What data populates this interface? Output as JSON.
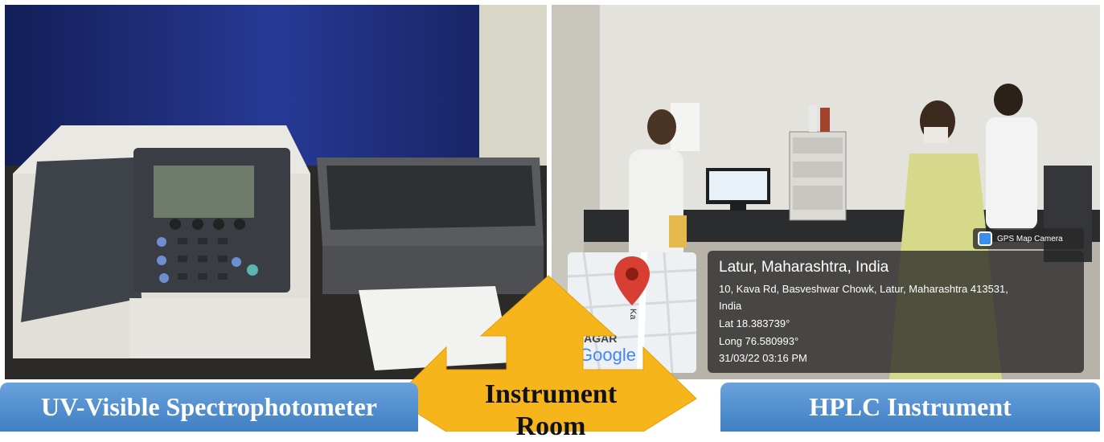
{
  "labels": {
    "left": "UV-Visible Spectrophotometer",
    "right": "HPLC Instrument",
    "center_line1": "Instrument",
    "center_line2": "Room"
  },
  "gps": {
    "badge": "GPS Map Camera",
    "location": "Latur, Maharashtra, India",
    "address_line1": "10, Kava Rd, Basveshwar Chowk, Latur, Maharashtra 413531,",
    "address_line2": "India",
    "lat": "Lat 18.383739°",
    "long": "Long 76.580993°",
    "datetime": "31/03/22 03:16 PM"
  },
  "map": {
    "logo": "Google",
    "area_text": "NAGAR",
    "road_text": "Ka"
  },
  "colors": {
    "label_bar": "#4a8ad0",
    "arrow": "#f6b51b"
  }
}
